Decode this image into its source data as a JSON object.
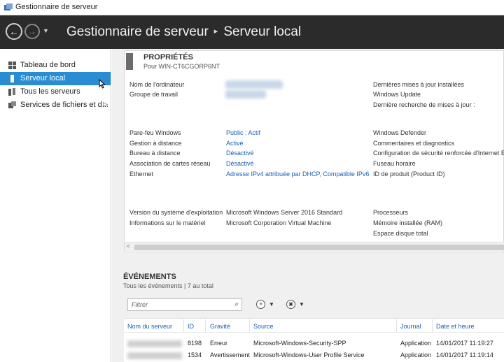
{
  "window": {
    "title": "Gestionnaire de serveur"
  },
  "header": {
    "app": "Gestionnaire de serveur",
    "separator": "▸",
    "current": "Serveur local",
    "back_icon": "arrow-left-icon",
    "forward_icon": "arrow-right-icon"
  },
  "sidebar": {
    "items": [
      {
        "label": "Tableau de bord",
        "icon": "dashboard-icon"
      },
      {
        "label": "Serveur local",
        "icon": "server-icon",
        "selected": true
      },
      {
        "label": "Tous les serveurs",
        "icon": "servers-icon"
      },
      {
        "label": "Services de fichiers et d...",
        "icon": "file-services-icon",
        "arrow": "▷"
      }
    ]
  },
  "properties": {
    "title": "PROPRIÉTÉS",
    "subtitle": "Pour WIN-CT6CGORP6NT",
    "col1_labels": [
      "Nom de l'ordinateur",
      "Groupe de travail",
      "Pare-feu Windows",
      "Gestion à distance",
      "Bureau à distance",
      "Association de cartes réseau",
      "Ethernet",
      "Version du système d'exploitation",
      "Informations sur le matériel"
    ],
    "col1_values": [
      "Public : Actif",
      "Activé",
      "Désactivé",
      "Désactivé",
      "Adresse IPv4 attribuée par DHCP, Compatible IPv6",
      "Microsoft Windows Server 2016 Standard",
      "Microsoft Corporation Virtual Machine"
    ],
    "col2_labels": [
      "Dernières mises à jour installées",
      "Windows Update",
      "Dernière recherche de mises à jour :",
      "Windows Defender",
      "Commentaires et diagnostics",
      "Configuration de sécurité renforcée d'Internet Ex",
      "Fuseau horaire",
      "ID de produit (Product ID)",
      "Processeurs",
      "Mémoire installée (RAM)",
      "Espace disque total"
    ]
  },
  "events": {
    "title": "ÉVÉNEMENTS",
    "subtitle": "Tous les événements | 7 au total",
    "filter_placeholder": "Filtrer",
    "search_icon": "⌕",
    "columns": [
      "Nom du serveur",
      "ID",
      "Gravité",
      "Source",
      "Journal",
      "Date et heure"
    ],
    "rows": [
      {
        "id": "8198",
        "severity": "Erreur",
        "source": "Microsoft-Windows-Security-SPP",
        "log": "Application",
        "date": "14/01/2017 11:19:27"
      },
      {
        "id": "1534",
        "severity": "Avertissement",
        "source": "Microsoft-Windows-User Profile Service",
        "log": "Application",
        "date": "14/01/2017 11:19:14"
      }
    ]
  }
}
